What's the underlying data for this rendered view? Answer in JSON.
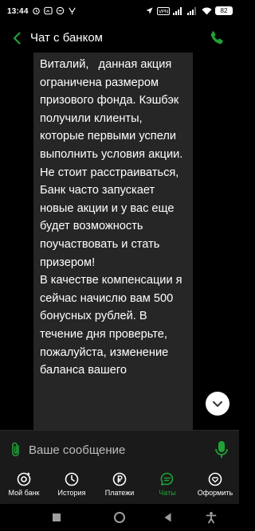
{
  "status_bar": {
    "time": "13:44",
    "battery": "82",
    "icons_left": [
      "alarm-icon",
      "app-icon",
      "do-not-disturb-icon",
      "signal-arrow-icon"
    ],
    "icons_right": [
      "location-icon",
      "vpn-icon",
      "signal-icon",
      "signal-icon",
      "wifi-icon",
      "battery-icon"
    ]
  },
  "header": {
    "title": "Чат с банком",
    "back_icon": "chevron-left-icon",
    "call_icon": "phone-icon"
  },
  "chat": {
    "message_text": "Виталий,   данная акция ограничена размером призового фонда. Кэшбэк получили клиенты, которые первыми успели выполнить условия акции.  Не стоит расстраиваться, Банк часто запускает новые акции и у вас еще будет возможность поучаствовать и стать призером!\nВ качестве компенсации я сейчас начислю вам 500 бонусных рублей. В течение дня проверьте, пожалуйста, изменение баланса вашего"
  },
  "composer": {
    "placeholder": "Ваше сообщение"
  },
  "tabs": [
    {
      "label": "Мой банк",
      "icon": "home-icon",
      "active": false
    },
    {
      "label": "История",
      "icon": "clock-icon",
      "active": false
    },
    {
      "label": "Платежи",
      "icon": "ruble-icon",
      "active": false
    },
    {
      "label": "Чаты",
      "icon": "chat-icon",
      "active": true
    },
    {
      "label": "Оформить",
      "icon": "heart-icon",
      "active": false
    }
  ],
  "colors": {
    "accent": "#21a038",
    "background": "#000000",
    "bubble": "#262626",
    "panel": "#1a1a1a"
  }
}
